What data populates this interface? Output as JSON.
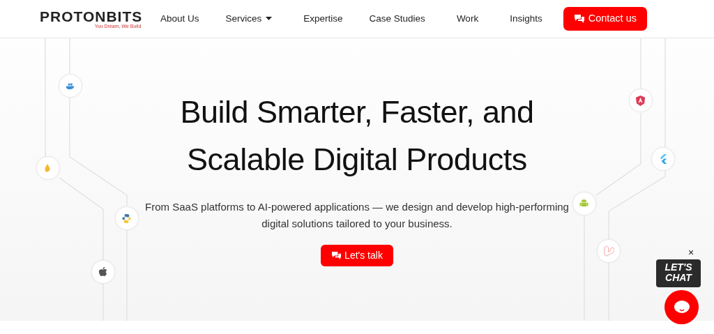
{
  "header": {
    "logo": "PROTONBITS",
    "tagline": "You Dream, We Build",
    "nav": [
      {
        "label": "About Us",
        "dropdown": false
      },
      {
        "label": "Services",
        "dropdown": true
      },
      {
        "label": "Expertise",
        "dropdown": false
      },
      {
        "label": "Case Studies",
        "dropdown": false
      },
      {
        "label": "Work",
        "dropdown": false
      },
      {
        "label": "Insights",
        "dropdown": false
      }
    ],
    "cta": "Contact us"
  },
  "hero": {
    "title_lines": [
      "Build Smarter, Faster, and",
      "Scalable Digital Products"
    ],
    "subtitle": "From SaaS platforms to AI-powered applications — we design and develop high-performing digital solutions tailored to your business.",
    "button": "Let's talk"
  },
  "chat_widget": {
    "close": "×",
    "sticker": "LET'S CHAT"
  }
}
